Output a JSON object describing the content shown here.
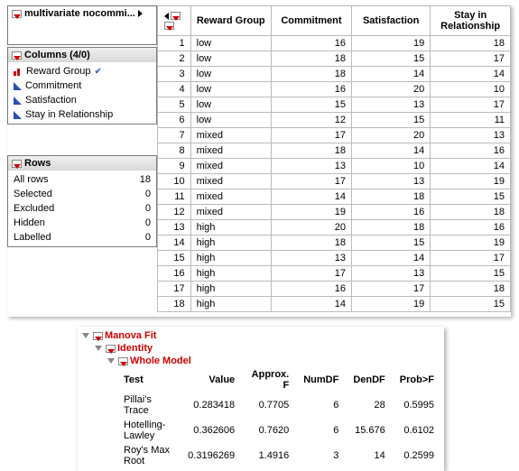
{
  "header": {
    "title": "multivariate nocommi..."
  },
  "columns": {
    "title": "Columns (4/0)",
    "items": [
      {
        "name": "Reward Group",
        "type": "bar",
        "checked": true
      },
      {
        "name": "Commitment",
        "type": "cont",
        "checked": false
      },
      {
        "name": "Satisfaction",
        "type": "cont",
        "checked": false
      },
      {
        "name": "Stay in Relationship",
        "type": "cont",
        "checked": false
      }
    ]
  },
  "rows": {
    "title": "Rows",
    "items": [
      {
        "label": "All rows",
        "value": "18"
      },
      {
        "label": "Selected",
        "value": "0"
      },
      {
        "label": "Excluded",
        "value": "0"
      },
      {
        "label": "Hidden",
        "value": "0"
      },
      {
        "label": "Labelled",
        "value": "0"
      }
    ]
  },
  "chart_data": {
    "type": "table",
    "columns": [
      "",
      "Reward Group",
      "Commitment",
      "Satisfaction",
      "Stay in Relationship"
    ],
    "rows": [
      [
        1,
        "low",
        16,
        19,
        18
      ],
      [
        2,
        "low",
        18,
        15,
        17
      ],
      [
        3,
        "low",
        18,
        14,
        14
      ],
      [
        4,
        "low",
        16,
        20,
        10
      ],
      [
        5,
        "low",
        15,
        13,
        17
      ],
      [
        6,
        "low",
        12,
        15,
        11
      ],
      [
        7,
        "mixed",
        17,
        20,
        13
      ],
      [
        8,
        "mixed",
        18,
        14,
        16
      ],
      [
        9,
        "mixed",
        13,
        10,
        14
      ],
      [
        10,
        "mixed",
        17,
        13,
        19
      ],
      [
        11,
        "mixed",
        14,
        18,
        15
      ],
      [
        12,
        "mixed",
        19,
        16,
        18
      ],
      [
        13,
        "high",
        20,
        18,
        16
      ],
      [
        14,
        "high",
        18,
        15,
        19
      ],
      [
        15,
        "high",
        13,
        14,
        17
      ],
      [
        16,
        "high",
        17,
        13,
        15
      ],
      [
        17,
        "high",
        16,
        17,
        18
      ],
      [
        18,
        "high",
        14,
        19,
        15
      ]
    ]
  },
  "manova": {
    "title": "Manova Fit",
    "identity": "Identity",
    "wholemodel": "Whole Model",
    "headers": [
      "Test",
      "Value",
      "Approx. F",
      "NumDF",
      "DenDF",
      "Prob>F"
    ],
    "tests": [
      {
        "name": "Pillai's Trace",
        "value": "0.283418",
        "f": "0.7705",
        "ndf": "6",
        "ddf": "28",
        "p": "0.5995"
      },
      {
        "name": "Hotelling-Lawley",
        "value": "0.362606",
        "f": "0.7620",
        "ndf": "6",
        "ddf": "15.676",
        "p": "0.6102"
      },
      {
        "name": "Roy's Max Root",
        "value": "0.3196269",
        "f": "1.4916",
        "ndf": "3",
        "ddf": "14",
        "p": "0.2599"
      }
    ]
  }
}
